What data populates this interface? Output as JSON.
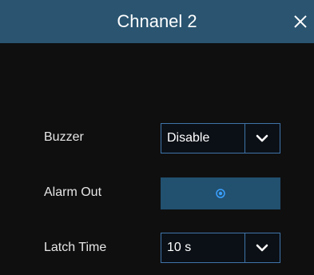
{
  "dialog": {
    "title": "Chnanel 2"
  },
  "fields": {
    "buzzer": {
      "label": "Buzzer",
      "value": "Disable"
    },
    "alarm_out": {
      "label": "Alarm Out"
    },
    "latch_time": {
      "label": "Latch Time",
      "value": "10 s"
    }
  },
  "icons": {
    "close": "close-icon",
    "chevron": "chevron-down-icon",
    "radio": "radio-selected-icon"
  },
  "colors": {
    "titlebar": "#2a5470",
    "background": "#0f0f10",
    "accent_border": "#3f74a8",
    "alarm_button": "#22506f",
    "radio": "#3aa0ff"
  }
}
